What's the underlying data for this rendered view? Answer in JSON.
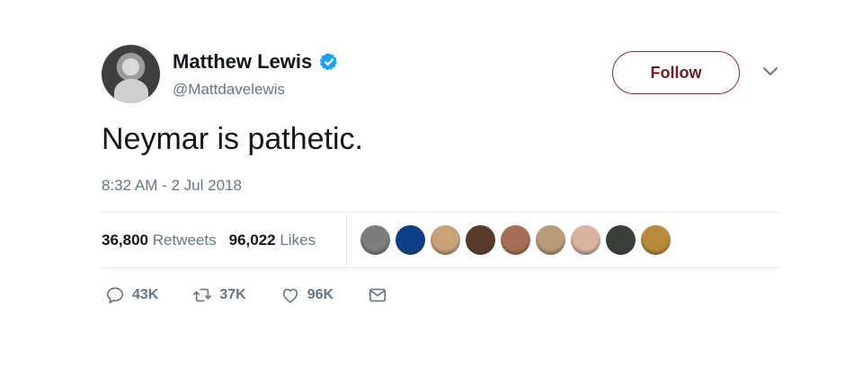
{
  "user": {
    "display_name": "Matthew Lewis",
    "handle": "@Mattdavelewis",
    "verified": true
  },
  "follow_button": {
    "label": "Follow"
  },
  "tweet": {
    "text": "Neymar is pathetic.",
    "timestamp": "8:32 AM - 2 Jul 2018"
  },
  "stats": {
    "retweets_count": "36,800",
    "retweets_label": "Retweets",
    "likes_count": "96,022",
    "likes_label": "Likes"
  },
  "likers": [
    {
      "icon": "liker-avatar",
      "color": "#7d7d7d"
    },
    {
      "icon": "liker-avatar",
      "color": "#0d3f86"
    },
    {
      "icon": "liker-avatar",
      "color": "#c9a27a"
    },
    {
      "icon": "liker-avatar",
      "color": "#5a3a2b"
    },
    {
      "icon": "liker-avatar",
      "color": "#a46f55"
    },
    {
      "icon": "liker-avatar",
      "color": "#b89b77"
    },
    {
      "icon": "liker-avatar",
      "color": "#d8b4a0"
    },
    {
      "icon": "liker-avatar",
      "color": "#3a3f3a"
    },
    {
      "icon": "liker-avatar",
      "color": "#b98a3c"
    }
  ],
  "actions": {
    "reply_count": "43K",
    "retweet_count": "37K",
    "like_count": "96K"
  },
  "colors": {
    "verified_blue": "#1da1f2",
    "muted_text": "#657786",
    "follow_border": "#8a2b2b"
  }
}
